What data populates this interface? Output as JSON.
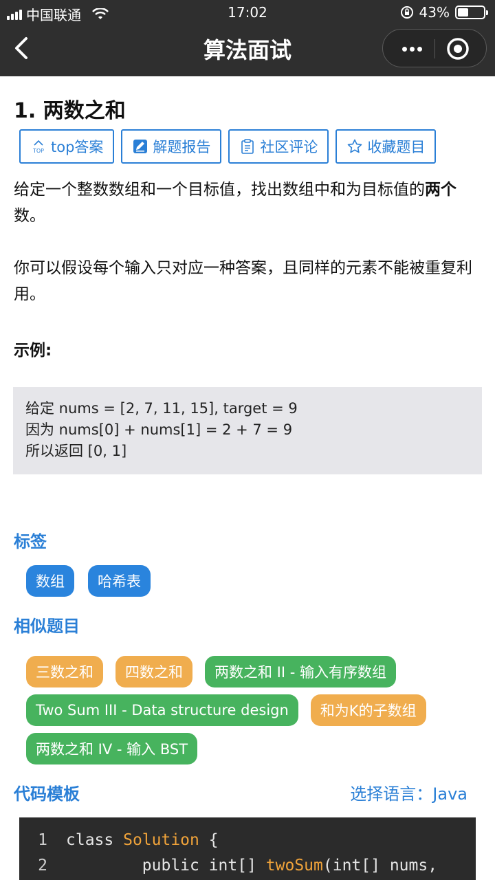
{
  "status_bar": {
    "carrier": "中国联通",
    "time": "17:02",
    "battery_percent": "43%",
    "battery_level": 0.43
  },
  "nav": {
    "title": "算法面试"
  },
  "question": {
    "title": "1. 两数之和",
    "actions": [
      {
        "label": "top答案",
        "icon": "top-icon"
      },
      {
        "label": "解题报告",
        "icon": "edit-icon"
      },
      {
        "label": "社区评论",
        "icon": "clipboard-icon"
      },
      {
        "label": "收藏题目",
        "icon": "star-icon"
      }
    ],
    "desc_1": "给定一个整数数组和一个目标值，找出数组中和为目标值的",
    "desc_1_bold": "两个",
    "desc_1_end": "数。",
    "desc_2": "你可以假设每个输入只对应一种答案，且同样的元素不能被重复利用。",
    "example_heading": "示例:",
    "example_lines": [
      "给定 nums = [2, 7, 11, 15], target = 9",
      "因为 nums[0] + nums[1] = 2 + 7 = 9",
      "所以返回 [0, 1]"
    ]
  },
  "tags": {
    "heading": "标签",
    "items": [
      "数组",
      "哈希表"
    ]
  },
  "similar": {
    "heading": "相似题目",
    "items": [
      {
        "label": "三数之和",
        "color": "orange"
      },
      {
        "label": "四数之和",
        "color": "orange"
      },
      {
        "label": "两数之和 II - 输入有序数组",
        "color": "green"
      },
      {
        "label": "Two Sum III - Data structure design",
        "color": "green"
      },
      {
        "label": "和为K的子数组",
        "color": "orange"
      },
      {
        "label": "两数之和 IV - 输入 BST",
        "color": "green"
      }
    ]
  },
  "code_template": {
    "heading": "代码模板",
    "language_select": "选择语言：Java",
    "lines": [
      {
        "no": "1",
        "text_a": "class ",
        "text_kw": "Solution",
        "text_b": " {"
      },
      {
        "no": "2",
        "text_a": "        public int[] ",
        "text_kw": "twoSum",
        "text_b": "(int[] nums,"
      }
    ]
  },
  "colors": {
    "accent": "#2a7fd6",
    "tag_blue": "#2a84dd",
    "pill_orange": "#f0ad4e",
    "pill_green": "#47b35e",
    "topbar": "#2f2f2f",
    "code_bg": "#2b2b2b",
    "code_keyword": "#f0a33a"
  }
}
